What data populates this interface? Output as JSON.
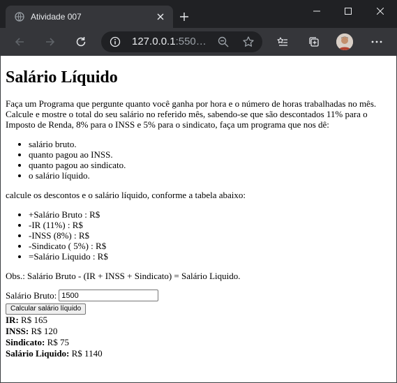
{
  "browser": {
    "tab_title": "Atividade 007",
    "url_host": "127.0.0.1",
    "url_port": ":550…",
    "accent": "#8ab4f8"
  },
  "icons": {
    "favicon": "globe-icon",
    "tab_close": "close-icon",
    "new_tab": "plus-icon",
    "back": "arrow-left-icon",
    "forward": "arrow-right-icon",
    "reload": "reload-icon",
    "site_info": "info-icon",
    "zoom": "zoom-out-icon",
    "bookmark": "star-icon",
    "reading_list": "reading-list-icon",
    "collections": "collections-icon",
    "menu": "more-icon"
  },
  "page": {
    "title": "Salário Líquido",
    "intro": "Faça um Programa que pergunte quanto você ganha por hora e o número de horas trabalhadas no mês. Calcule e mostre o total do seu salário no referido mês, sabendo-se que são descontados 11% para o Imposto de Renda, 8% para o INSS e 5% para o sindicato, faça um programa que nos dê:",
    "list1": [
      "salário bruto.",
      "quanto pagou ao INSS.",
      "quanto pagou ao sindicato.",
      "o salário líquido."
    ],
    "table_intro": "calcule os descontos e o salário líquido, conforme a tabela abaixo:",
    "list2": [
      "+Salário Bruto : R$",
      "-IR (11%) : R$",
      "-INSS (8%) : R$",
      "-Sindicato ( 5%) : R$",
      "=Salário Liquido : R$"
    ],
    "obs": "Obs.: Salário Bruto - (IR + INSS + Sindicato) = Salário Liquido."
  },
  "form": {
    "label": "Salário Bruto:",
    "value": "1500",
    "button_label": "Calcular salário líquido"
  },
  "results": {
    "ir_label": "IR:",
    "ir_value": "R$ 165",
    "inss_label": "INSS:",
    "inss_value": "R$ 120",
    "sindicato_label": "Sindicato:",
    "sindicato_value": "R$ 75",
    "liquido_label": "Salário Liquido:",
    "liquido_value": "R$ 1140"
  }
}
